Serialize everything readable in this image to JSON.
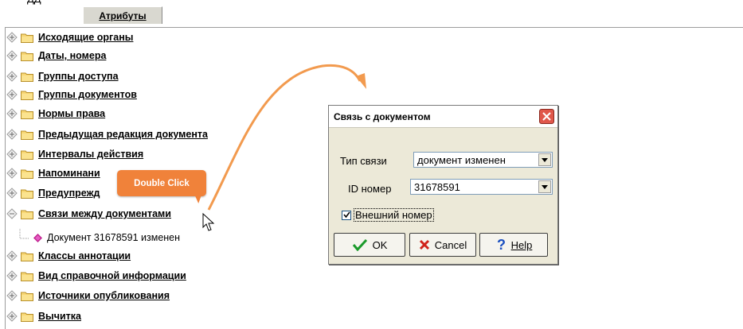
{
  "header": {
    "top_fragment": "ДД",
    "tab_label": "Атрибуты"
  },
  "tree": {
    "items": [
      {
        "label": "Исходящие органы"
      },
      {
        "label": "Даты, номера"
      },
      {
        "label": "Группы доступа"
      },
      {
        "label": "Группы документов"
      },
      {
        "label": "Нормы права"
      },
      {
        "label": "Предыдущая редакция документа"
      },
      {
        "label": "Интервалы действия"
      },
      {
        "label": "Напоминани"
      },
      {
        "label": "Предупрежд"
      },
      {
        "label": "Связи между документами"
      },
      {
        "label": "Классы аннотации"
      },
      {
        "label": "Вид справочной информации"
      },
      {
        "label": "Источники опубликования"
      },
      {
        "label": "Вычитка"
      }
    ],
    "child": {
      "label": "Документ 31678591 изменен"
    }
  },
  "tooltip": {
    "text": "Double Click"
  },
  "dialog": {
    "title": "Связь с документом",
    "link_type_label": "Тип связи",
    "link_type_value": "документ изменен",
    "id_label": "ID номер",
    "id_value": "31678591",
    "external_label": "Внешний номер",
    "external_checked": true,
    "ok_label": "OK",
    "cancel_label": "Cancel",
    "help_label": "Help"
  },
  "colors": {
    "tooltip_bg": "#f0823a",
    "arrow": "#f29a4e",
    "selection": "#e3e3e3",
    "dialog_bg": "#ece9d8"
  }
}
